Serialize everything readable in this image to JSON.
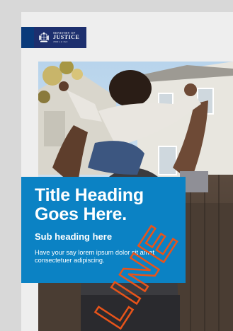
{
  "logo": {
    "line1": "MINISTRY OF",
    "line2": "JUSTICE",
    "tagline": "Tāhū o te Ture",
    "crest_icon": "coat-of-arms-icon"
  },
  "poster": {
    "title": "Title Heading Goes Here.",
    "subtitle": "Sub heading here",
    "body": "Have your say lorem ipsum dolor sit amet consectetuer adipiscing."
  },
  "watermark": {
    "text": "LINE"
  },
  "colors": {
    "background": "#d8d8d8",
    "page": "#eeeeee",
    "logo_navy": "#1d2f6e",
    "panel_blue": "#0b82c4",
    "accent_bar": "#2d5a80",
    "watermark_orange": "#e8541a"
  }
}
